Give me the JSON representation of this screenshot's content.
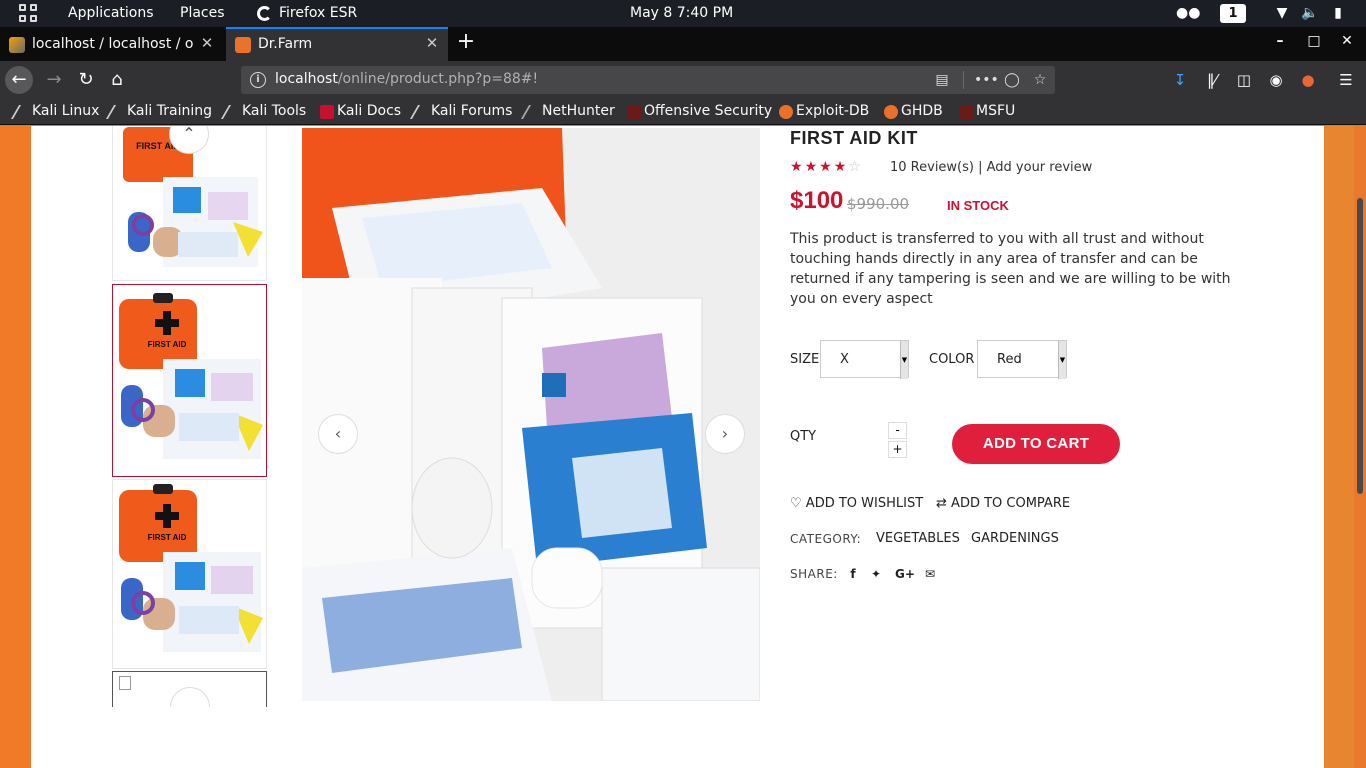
{
  "gnome_bar": {
    "applications": "Applications",
    "places": "Places",
    "browser_name": "Firefox ESR",
    "clock": "May 8   7:40 PM",
    "workspace": "1"
  },
  "tabs": [
    {
      "title": "localhost / localhost / onli",
      "active": false
    },
    {
      "title": "Dr.Farm",
      "active": true
    }
  ],
  "navbar": {
    "url_host": "localhost",
    "url_path": "/online/product.php?p=88#!"
  },
  "bookmarks": [
    {
      "label": "Kali Linux",
      "icon": "kali-dragon-icon"
    },
    {
      "label": "Kali Training",
      "icon": "kali-dragon-icon"
    },
    {
      "label": "Kali Tools",
      "icon": "kali-dragon-icon"
    },
    {
      "label": "Kali Docs",
      "icon": "kali-docs-icon"
    },
    {
      "label": "Kali Forums",
      "icon": "kali-dragon-icon"
    },
    {
      "label": "NetHunter",
      "icon": "nethunter-icon"
    },
    {
      "label": "Offensive Security",
      "icon": "offsec-icon"
    },
    {
      "label": "Exploit-DB",
      "icon": "exploitdb-icon"
    },
    {
      "label": "GHDB",
      "icon": "ghdb-icon"
    },
    {
      "label": "MSFU",
      "icon": "msfu-icon"
    }
  ],
  "product": {
    "title": "FIRST AID KIT",
    "rating_stars": 4,
    "rating_max": 5,
    "reviews_text": "10 Review(s) | Add your review",
    "price": "$100",
    "old_price": "$990.00",
    "stock": "IN STOCK",
    "description": "This product is transferred to you with all trust and without touching hands directly in any area of transfer and can be returned if any tampering is seen and we are willing to be with you on every aspect",
    "size_label": "SIZE",
    "size_value": "X",
    "color_label": "COLOR",
    "color_value": "Red",
    "qty_label": "QTY",
    "qty_minus": "-",
    "qty_plus": "+",
    "add_to_cart": "ADD TO CART",
    "wishlist": "ADD TO WISHLIST",
    "compare": "ADD TO COMPARE",
    "category_label": "CATEGORY:",
    "categories": [
      "VEGETABLES",
      "GARDENINGS"
    ],
    "share_label": "SHARE:",
    "share_icons": [
      "facebook-icon",
      "twitter-icon",
      "google-plus-icon",
      "email-icon"
    ],
    "thumb_caption": "FIRST AID"
  },
  "colors": {
    "accent": "#e01f3d",
    "price": "#d0102f",
    "page_bg": "#f07a28",
    "selected_thumb_border": "#b4122f"
  }
}
